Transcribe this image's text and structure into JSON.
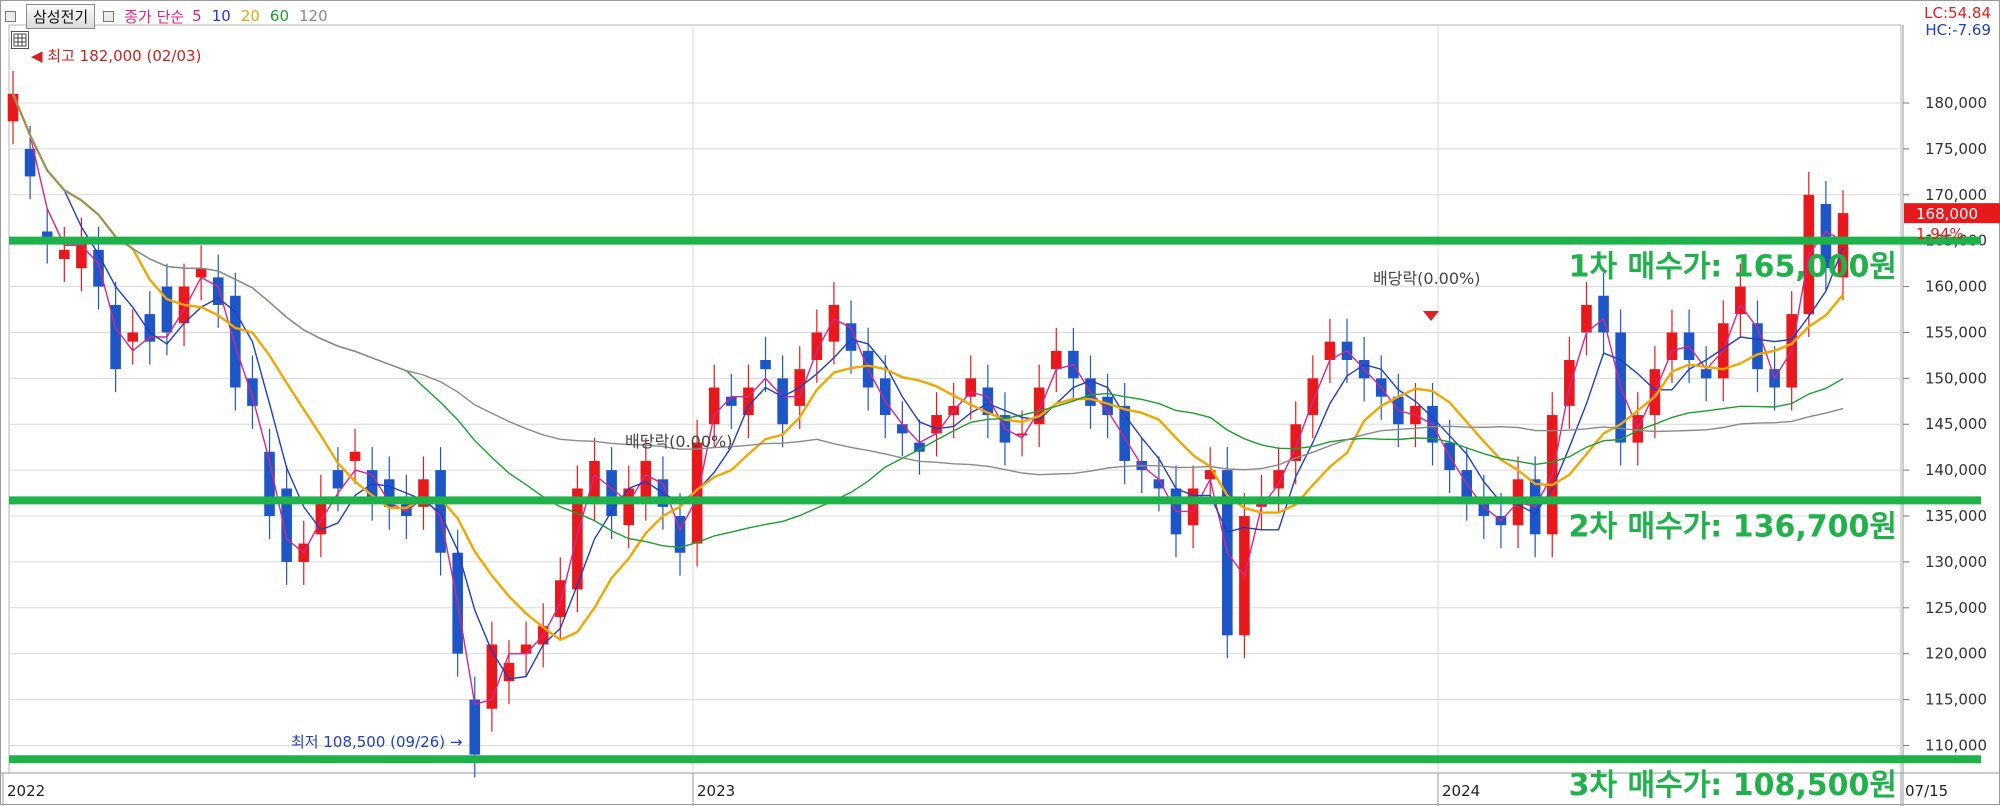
{
  "header": {
    "stock_name": "삼성전기",
    "ma_title": "종가 단순",
    "ma_periods": [
      {
        "label": "5",
        "color": "#d4268c"
      },
      {
        "label": "10",
        "color": "#1f3fc4"
      },
      {
        "label": "20",
        "color": "#f0a800"
      },
      {
        "label": "60",
        "color": "#1aa02e"
      },
      {
        "label": "120",
        "color": "#8a8a8a"
      }
    ],
    "lc_label": "LC:54.84",
    "hc_label": "HC:-7.69",
    "lc_color": "#e02020",
    "hc_color": "#1f3fc4"
  },
  "colors": {
    "up_candle": "#e8191c",
    "down_candle": "#1e56c8",
    "support_line": "#1fb24a",
    "grid": "#d9d9d9",
    "annotation_text": "#1fb24a"
  },
  "chart_data": {
    "type": "candlestick",
    "title": "",
    "x_axis_labels": [
      "2022",
      "2023",
      "2024",
      "07/15"
    ],
    "y_ticks": [
      "110,000",
      "115,000",
      "120,000",
      "125,000",
      "130,000",
      "135,000",
      "140,000",
      "145,000",
      "150,000",
      "155,000",
      "160,000",
      "165,000",
      "170,000",
      "175,000",
      "180,000"
    ],
    "ylim": [
      107000,
      188500
    ],
    "period": "2022-01 to 2024-07 (monthly approx.)",
    "candles_open_close": [
      [
        178000,
        181000
      ],
      [
        175000,
        172000
      ],
      [
        166000,
        165000
      ],
      [
        163000,
        164000
      ],
      [
        162000,
        165000
      ],
      [
        164000,
        160000
      ],
      [
        158000,
        151000
      ],
      [
        154000,
        155000
      ],
      [
        157000,
        154000
      ],
      [
        160000,
        155000
      ],
      [
        156000,
        160000
      ],
      [
        161000,
        162000
      ],
      [
        161000,
        158000
      ],
      [
        159000,
        149000
      ],
      [
        150000,
        147000
      ],
      [
        142000,
        135000
      ],
      [
        138000,
        130000
      ],
      [
        130000,
        132000
      ],
      [
        133000,
        137000
      ],
      [
        140000,
        138000
      ],
      [
        141000,
        142000
      ],
      [
        140000,
        137000
      ],
      [
        139000,
        136000
      ],
      [
        137000,
        135000
      ],
      [
        136000,
        139000
      ],
      [
        140000,
        131000
      ],
      [
        131000,
        120000
      ],
      [
        115000,
        109000
      ],
      [
        114000,
        121000
      ],
      [
        117000,
        119000
      ],
      [
        120000,
        121000
      ],
      [
        121000,
        123000
      ],
      [
        124000,
        128000
      ],
      [
        127000,
        138000
      ],
      [
        137000,
        141000
      ],
      [
        140000,
        135000
      ],
      [
        134000,
        138000
      ],
      [
        137000,
        141000
      ],
      [
        139000,
        136000
      ],
      [
        135000,
        131000
      ],
      [
        132000,
        143000
      ],
      [
        145000,
        149000
      ],
      [
        148000,
        147000
      ],
      [
        146000,
        149000
      ],
      [
        152000,
        151000
      ],
      [
        150000,
        145000
      ],
      [
        147000,
        151000
      ],
      [
        152000,
        155000
      ],
      [
        154000,
        158000
      ],
      [
        156000,
        153000
      ],
      [
        153000,
        149000
      ],
      [
        150000,
        146000
      ],
      [
        145000,
        144000
      ],
      [
        143000,
        142000
      ],
      [
        144000,
        146000
      ],
      [
        146000,
        147000
      ],
      [
        148000,
        150000
      ],
      [
        149000,
        146000
      ],
      [
        146000,
        143000
      ],
      [
        144000,
        144000
      ],
      [
        145000,
        149000
      ],
      [
        151000,
        153000
      ],
      [
        153000,
        150000
      ],
      [
        150000,
        147000
      ],
      [
        148000,
        146000
      ],
      [
        147000,
        141000
      ],
      [
        141000,
        140000
      ],
      [
        139000,
        138000
      ],
      [
        138000,
        133000
      ],
      [
        134000,
        138000
      ],
      [
        139000,
        140000
      ],
      [
        140000,
        122000
      ],
      [
        122000,
        135000
      ],
      [
        136000,
        137000
      ],
      [
        138000,
        140000
      ],
      [
        141000,
        145000
      ],
      [
        146000,
        150000
      ],
      [
        152000,
        154000
      ],
      [
        154000,
        152000
      ],
      [
        152000,
        150000
      ],
      [
        150000,
        148000
      ],
      [
        148000,
        145000
      ],
      [
        145000,
        147000
      ],
      [
        147000,
        143000
      ],
      [
        143000,
        140000
      ],
      [
        140000,
        137000
      ],
      [
        137000,
        135000
      ],
      [
        135000,
        134000
      ],
      [
        134000,
        139000
      ],
      [
        139000,
        133000
      ],
      [
        133000,
        146000
      ],
      [
        147000,
        152000
      ],
      [
        155000,
        158000
      ],
      [
        159000,
        155000
      ],
      [
        155000,
        143000
      ],
      [
        143000,
        146000
      ],
      [
        146000,
        151000
      ],
      [
        152000,
        155000
      ],
      [
        155000,
        152000
      ],
      [
        151000,
        150000
      ],
      [
        150000,
        156000
      ],
      [
        157000,
        160000
      ],
      [
        156000,
        151000
      ],
      [
        151000,
        149000
      ],
      [
        149000,
        157000
      ],
      [
        157000,
        170000
      ],
      [
        169000,
        162000
      ],
      [
        161000,
        168000
      ]
    ],
    "annotations": {
      "high": "최고 182,000 (02/03)",
      "low": "최저 108,500 (09/26)",
      "dividend_1": "배당락(0.00%)",
      "dividend_2": "배당락(0.00%)"
    },
    "current_price": "168,000",
    "change_pct": "1.94%",
    "support_levels": [
      {
        "value": 165000,
        "label": "1차 매수가: 165,000원"
      },
      {
        "value": 136700,
        "label": "2차 매수가: 136,700원"
      },
      {
        "value": 108500,
        "label": "3차 매수가: 108,500원"
      }
    ],
    "moving_averages": [
      "5",
      "10",
      "20",
      "60",
      "120"
    ],
    "grid": true
  }
}
